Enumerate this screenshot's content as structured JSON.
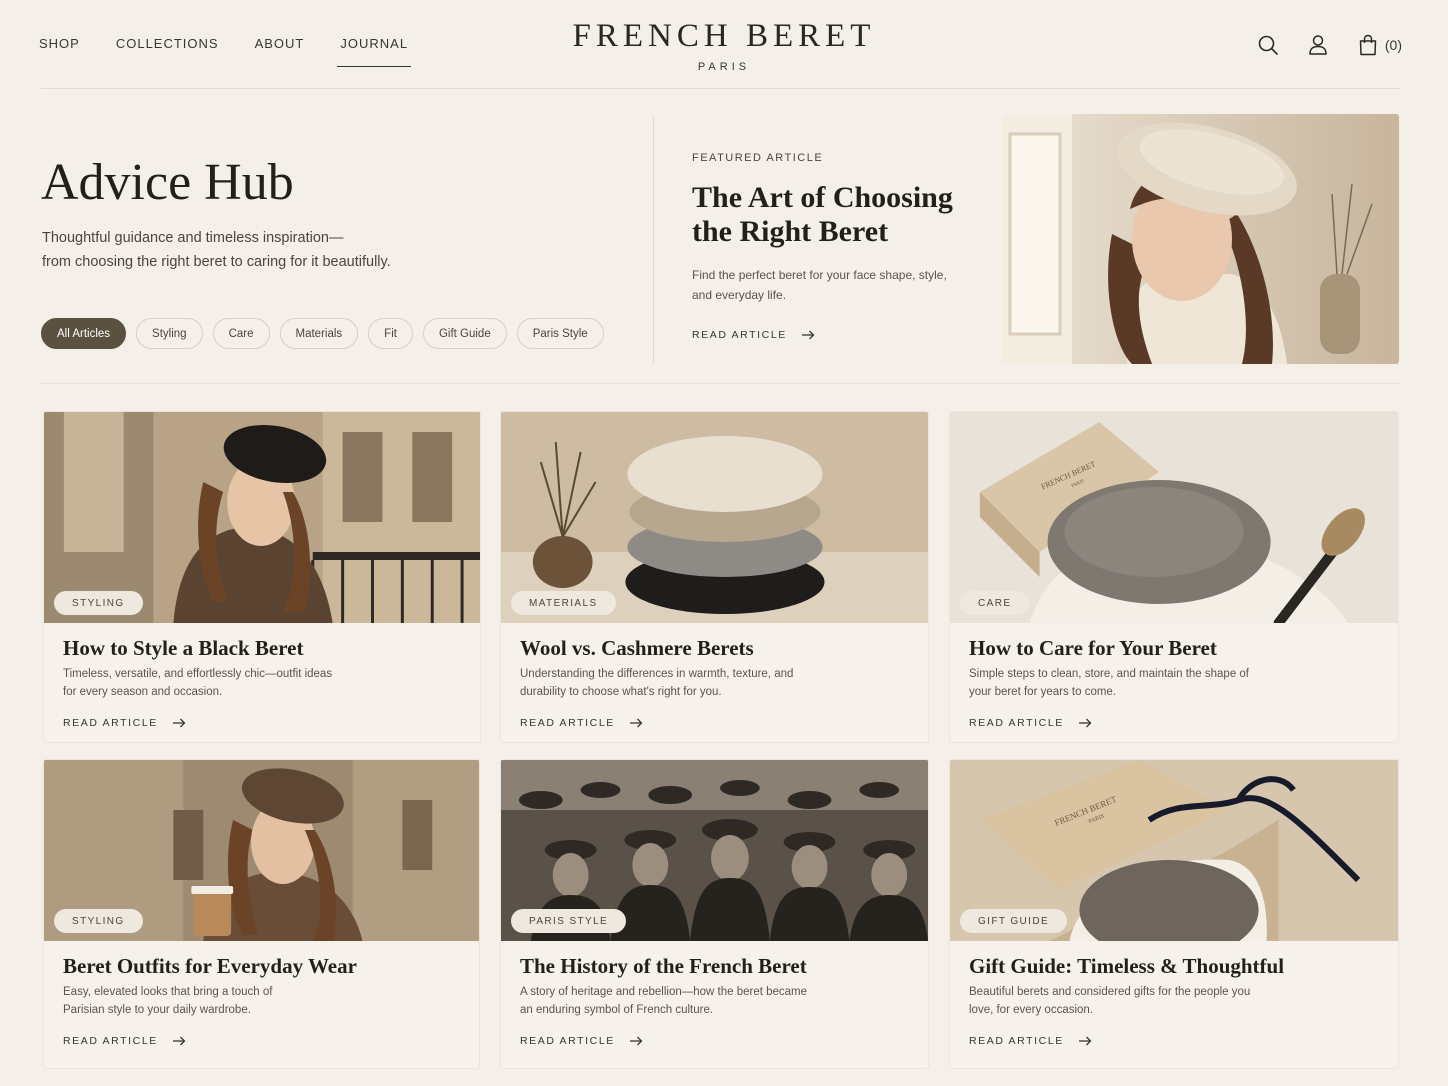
{
  "header": {
    "nav": [
      "SHOP",
      "COLLECTIONS",
      "ABOUT",
      "JOURNAL"
    ],
    "active_nav": "JOURNAL",
    "brand": "FRENCH BERET",
    "city": "PARIS",
    "cart_count": "(0)",
    "icons": [
      "search-icon",
      "user-icon",
      "bag-icon"
    ]
  },
  "hero": {
    "title": "Advice Hub",
    "subtitle_line1": "Thoughtful guidance and timeless inspiration—",
    "subtitle_line2": "from choosing the right beret to caring for it beautifully.",
    "filters": [
      "All Articles",
      "Styling",
      "Care",
      "Materials",
      "Fit",
      "Gift Guide",
      "Paris Style"
    ],
    "active_filter": "All Articles"
  },
  "featured": {
    "eyebrow": "FEATURED ARTICLE",
    "title": "The Art of Choosing the Right Beret",
    "description": "Find the perfect beret for your face shape, style, and everyday life.",
    "cta": "READ ARTICLE"
  },
  "articles": [
    {
      "tag": "STYLING",
      "title": "How to Style a Black Beret",
      "description": "Timeless, versatile, and effortlessly chic—outfit ideas for every season and occasion.",
      "cta": "READ ARTICLE"
    },
    {
      "tag": "MATERIALS",
      "title": "Wool vs. Cashmere Berets",
      "description": "Understanding the differences in warmth, texture, and durability to choose what's right for you.",
      "cta": "READ ARTICLE"
    },
    {
      "tag": "CARE",
      "title": "How to Care for Your Beret",
      "description": "Simple steps to clean, store, and maintain the shape of your beret for years to come.",
      "cta": "READ ARTICLE"
    },
    {
      "tag": "STYLING",
      "title": "Beret Outfits for Everyday Wear",
      "description": "Easy, elevated looks that bring a touch of Parisian style to your daily wardrobe.",
      "cta": "READ ARTICLE"
    },
    {
      "tag": "PARIS STYLE",
      "title": "The History of the French Beret",
      "description": "A story of heritage and rebellion—how the beret became an enduring symbol of French culture.",
      "cta": "READ ARTICLE"
    },
    {
      "tag": "GIFT GUIDE",
      "title": "Gift Guide: Timeless & Thoughtful",
      "description": "Beautiful berets and considered gifts for the people you love, for every occasion.",
      "cta": "READ ARTICLE"
    }
  ],
  "box_print": [
    "FRENCH BERET",
    "PARIS"
  ],
  "colors": {
    "background": "#f4efe8",
    "accent": "#5a5140",
    "text": "#2b2722"
  }
}
